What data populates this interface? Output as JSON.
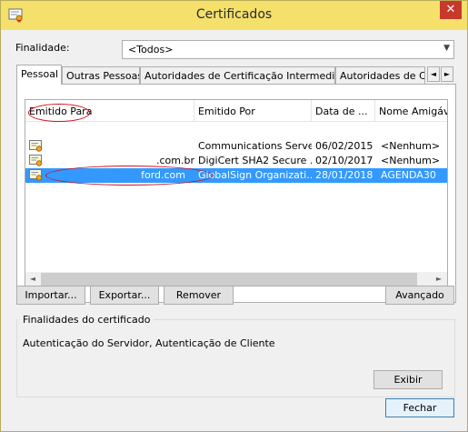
{
  "window": {
    "title": "Certificados",
    "close_glyph": "✕",
    "title_icon": "certificate-window-icon"
  },
  "finalidade": {
    "label": "Finalidade:",
    "value": "<Todos>"
  },
  "tabs": [
    {
      "label": "Pessoal"
    },
    {
      "label": "Outras Pessoas"
    },
    {
      "label": "Autoridades de Certificação Intermediárias"
    },
    {
      "label": "Autoridades de Ce"
    }
  ],
  "tab_scroll": {
    "left": "◄",
    "right": "►"
  },
  "list": {
    "columns": [
      "Emitido Para",
      "Emitido Por",
      "Data de ...",
      "Nome Amigáv"
    ],
    "rows": [
      {
        "issued_to": "",
        "issued_by": "Communications Server",
        "date": "06/02/2015",
        "friendly_name": "<Nenhum>"
      },
      {
        "issued_to": ".com.br",
        "issued_by": "DigiCert SHA2 Secure ...",
        "date": "02/10/2017",
        "friendly_name": "<Nenhum>"
      },
      {
        "issued_to": "ford.com",
        "issued_by": "GlobalSign Organizati...",
        "date": "28/01/2018",
        "friendly_name": "AGENDA30"
      }
    ],
    "scroll_left": "◄",
    "scroll_right": "►"
  },
  "buttons": {
    "importar": "Importar...",
    "exportar": "Exportar...",
    "remover": "Remover",
    "avancado": "Avançado",
    "exibir": "Exibir",
    "fechar": "Fechar"
  },
  "group": {
    "title": "Finalidades do certificado",
    "text": "Autenticação do Servidor, Autenticação de Cliente"
  },
  "colors": {
    "title_bar": "#f4e06b",
    "selection": "#3399ff",
    "annotation": "#d0101c",
    "close": "#c7392b"
  }
}
